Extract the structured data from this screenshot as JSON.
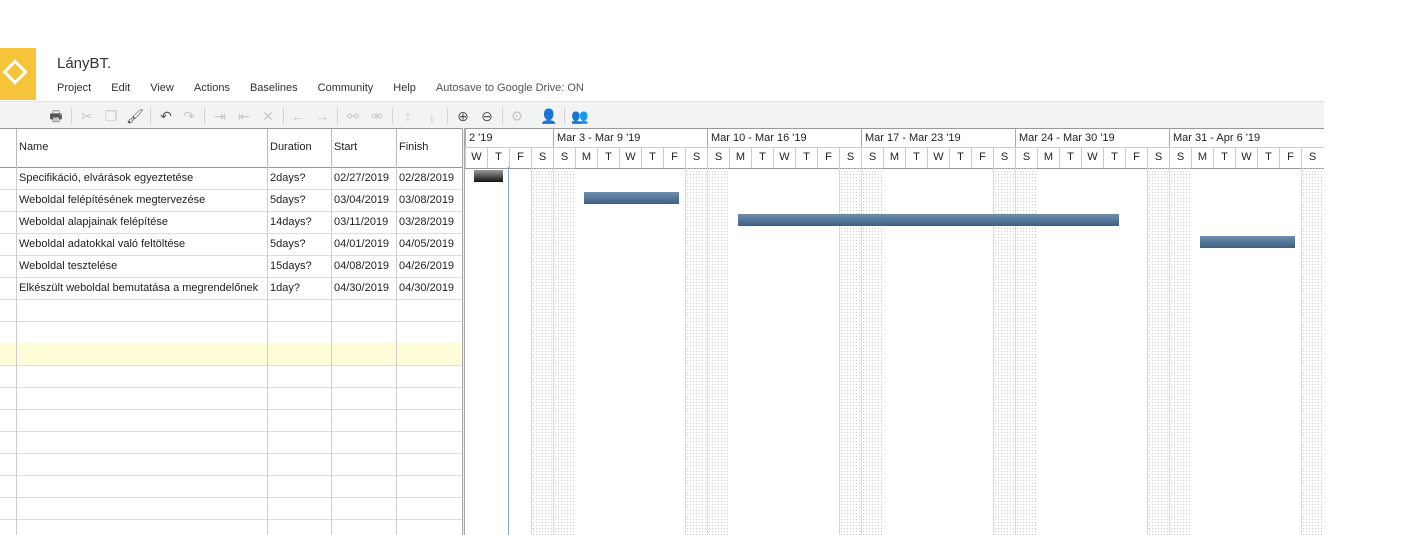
{
  "app": {
    "title": "LányBT."
  },
  "menu": [
    {
      "label": "Project"
    },
    {
      "label": "Edit"
    },
    {
      "label": "View"
    },
    {
      "label": "Actions"
    },
    {
      "label": "Baselines"
    },
    {
      "label": "Community"
    },
    {
      "label": "Help"
    }
  ],
  "autosave": "Autosave to Google Drive: ON",
  "toolbar": [
    {
      "icon": "print-icon",
      "glyph": "🖶",
      "enabled": true
    },
    {
      "icon": "cut-icon",
      "glyph": "✂",
      "enabled": false
    },
    {
      "icon": "copy-icon",
      "glyph": "❐",
      "enabled": false
    },
    {
      "icon": "paste-format-icon",
      "glyph": "🖌",
      "enabled": true
    },
    {
      "icon": "undo-icon",
      "glyph": "↶",
      "enabled": true
    },
    {
      "icon": "redo-icon",
      "glyph": "↷",
      "enabled": false
    },
    {
      "icon": "indent-icon",
      "glyph": "⇥",
      "enabled": false
    },
    {
      "icon": "outdent-icon",
      "glyph": "⇤",
      "enabled": false
    },
    {
      "icon": "delete-icon",
      "glyph": "✕",
      "enabled": false
    },
    {
      "icon": "arrow-left-icon",
      "glyph": "←",
      "enabled": false
    },
    {
      "icon": "arrow-right-icon",
      "glyph": "→",
      "enabled": false
    },
    {
      "icon": "link-icon",
      "glyph": "⚯",
      "enabled": false
    },
    {
      "icon": "unlink-icon",
      "glyph": "⚮",
      "enabled": false
    },
    {
      "icon": "move-up-icon",
      "glyph": "↑",
      "enabled": false
    },
    {
      "icon": "move-down-icon",
      "glyph": "↓",
      "enabled": false
    },
    {
      "icon": "zoom-in-icon",
      "glyph": "⊕",
      "enabled": true
    },
    {
      "icon": "zoom-out-icon",
      "glyph": "⊖",
      "enabled": true
    },
    {
      "icon": "settings-icon",
      "glyph": "⚙",
      "enabled": false
    },
    {
      "icon": "user-icon",
      "glyph": "👤",
      "enabled": false
    },
    {
      "icon": "user-settings-icon",
      "glyph": "👥",
      "enabled": false
    }
  ],
  "grid": {
    "columns": {
      "name": "Name",
      "duration": "Duration",
      "start": "Start",
      "finish": "Finish"
    },
    "tasks": [
      {
        "name": "Specifikáció, elvárások egyeztetése",
        "duration": "2days?",
        "start": "02/27/2019",
        "finish": "02/28/2019"
      },
      {
        "name": "Weboldal felépítésének megtervezése",
        "duration": "5days?",
        "start": "03/04/2019",
        "finish": "03/08/2019"
      },
      {
        "name": "Weboldal alapjainak felépítése",
        "duration": "14days?",
        "start": "03/11/2019",
        "finish": "03/28/2019"
      },
      {
        "name": "Weboldal adatokkal való feltöltése",
        "duration": "5days?",
        "start": "04/01/2019",
        "finish": "04/05/2019"
      },
      {
        "name": "Weboldal tesztelése",
        "duration": "15days?",
        "start": "04/08/2019",
        "finish": "04/26/2019"
      },
      {
        "name": "Elkészült weboldal bemutatása a megrendelőnek",
        "duration": "1day?",
        "start": "04/30/2019",
        "finish": "04/30/2019"
      }
    ],
    "empty_rows": 11,
    "selected_empty_row": 2
  },
  "gantt": {
    "weeks": [
      "2 '19",
      "Mar 3 - Mar 9 '19",
      "Mar 10 - Mar 16 '19",
      "Mar 17 - Mar 23 '19",
      "Mar 24 - Mar 30 '19",
      "Mar 31 - Apr 6 '19"
    ],
    "days": [
      "W",
      "T",
      "F",
      "S",
      "S",
      "M",
      "T",
      "W",
      "T",
      "F",
      "S",
      "S",
      "M",
      "T",
      "W",
      "T",
      "F",
      "S",
      "S",
      "M",
      "T",
      "W",
      "T",
      "F",
      "S",
      "S",
      "M",
      "T",
      "W",
      "T",
      "F",
      "S",
      "S",
      "M",
      "T",
      "W",
      "T",
      "F",
      "S"
    ],
    "first_day": "2019-02-27",
    "colors": {
      "bar": "#4f6f93",
      "milestone": "#222222"
    }
  }
}
